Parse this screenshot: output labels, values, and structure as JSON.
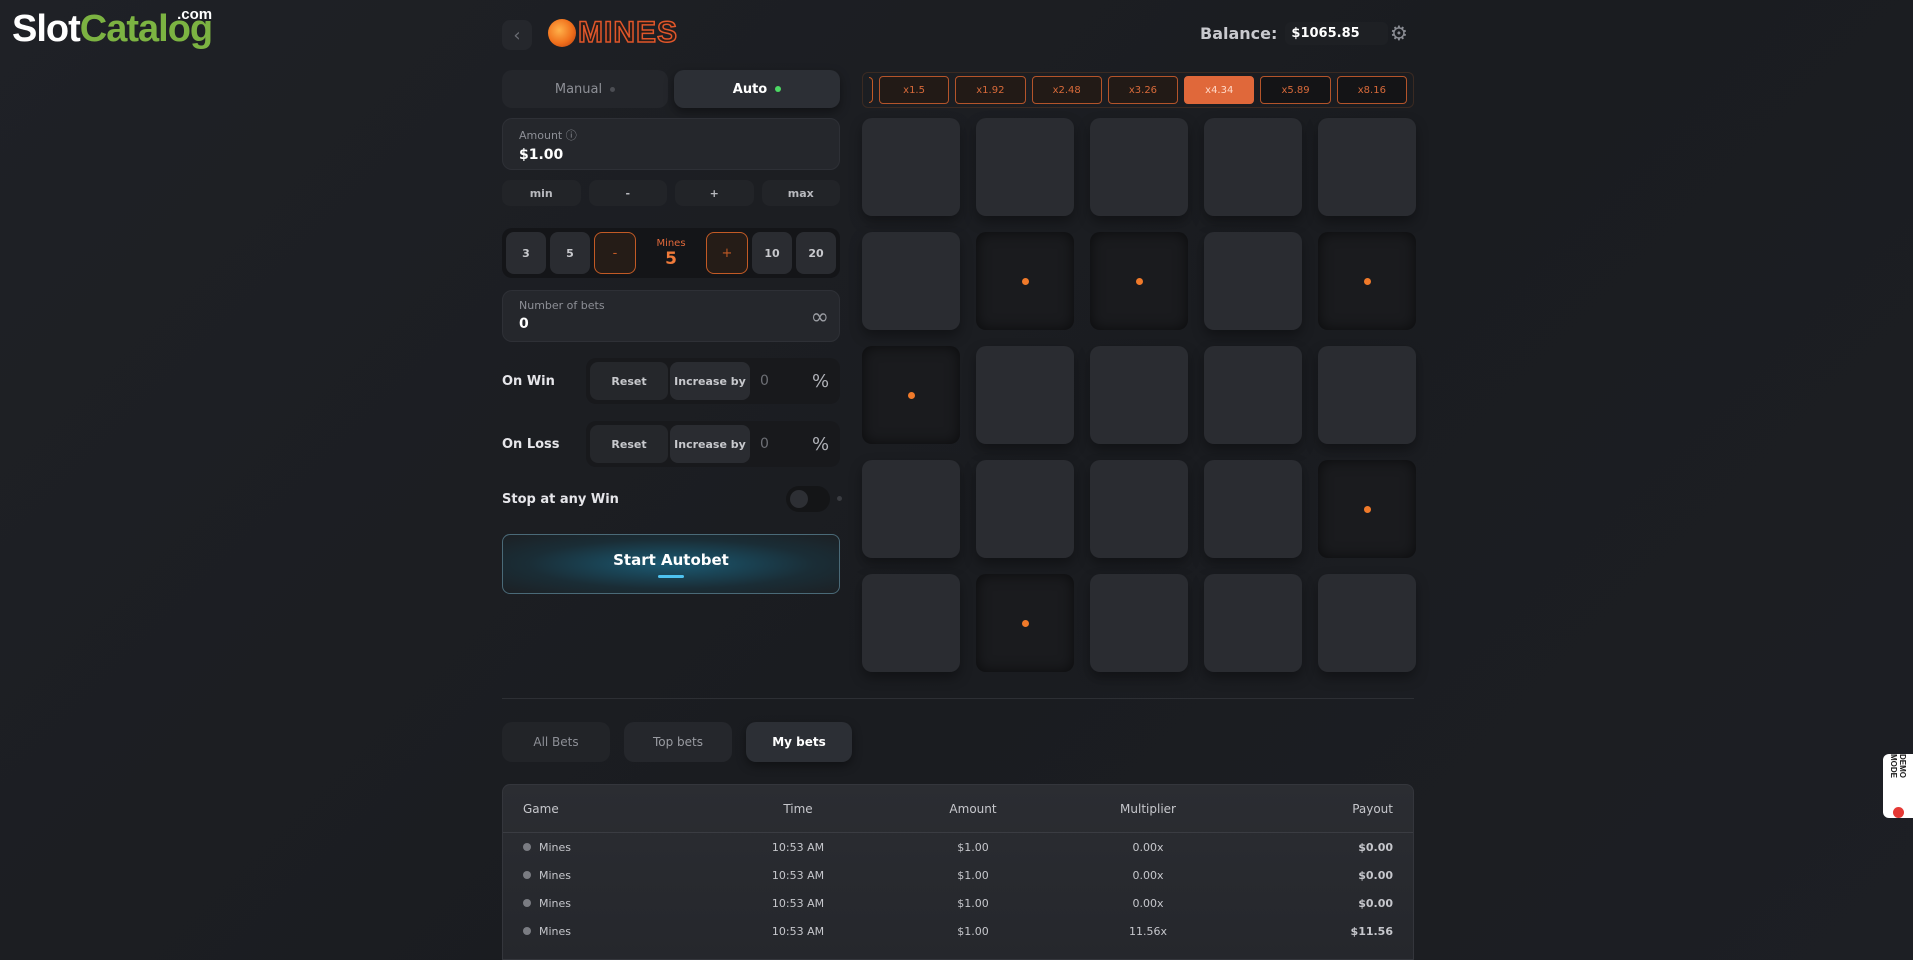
{
  "brand": {
    "slot": "Slot",
    "catalog": "Catalog",
    "com": ".com"
  },
  "header": {
    "back": "‹",
    "game_title": "MINES",
    "balance_label": "Balance:",
    "balance_value": "$1065.85",
    "gear": "⚙"
  },
  "mode_tabs": {
    "manual": "Manual",
    "auto": "Auto"
  },
  "amount": {
    "label": "Amount ⓘ",
    "value": "$1.00",
    "buttons": [
      "min",
      "-",
      "+",
      "max"
    ]
  },
  "mines": {
    "presets_left": [
      "3",
      "5"
    ],
    "minus": "-",
    "label": "Mines",
    "value": "5",
    "plus": "+",
    "presets_right": [
      "10",
      "20"
    ]
  },
  "number_of_bets": {
    "label": "Number of bets",
    "value": "0",
    "infinity": "∞"
  },
  "on_win": {
    "label": "On Win",
    "reset": "Reset",
    "increase": "Increase by",
    "value": "0",
    "pct": "%"
  },
  "on_loss": {
    "label": "On Loss",
    "reset": "Reset",
    "increase": "Increase by",
    "value": "0",
    "pct": "%"
  },
  "stop": {
    "label": "Stop at any Win"
  },
  "start": {
    "label": "Start Autobet"
  },
  "multipliers": [
    "x1.5",
    "x1.92",
    "x2.48",
    "x3.26",
    "x4.34",
    "x5.89",
    "x8.16"
  ],
  "grid": {
    "revealed": [
      6,
      7,
      9,
      10,
      19,
      21
    ]
  },
  "bet_tabs": [
    "All Bets",
    "Top bets",
    "My bets"
  ],
  "table": {
    "headers": [
      "Game",
      "Time",
      "Amount",
      "Multiplier",
      "Payout"
    ],
    "rows": [
      [
        "Mines",
        "10:53 AM",
        "$1.00",
        "0.00x",
        "$0.00"
      ],
      [
        "Mines",
        "10:53 AM",
        "$1.00",
        "0.00x",
        "$0.00"
      ],
      [
        "Mines",
        "10:53 AM",
        "$1.00",
        "0.00x",
        "$0.00"
      ],
      [
        "Mines",
        "10:53 AM",
        "$1.00",
        "11.56x",
        "$11.56"
      ]
    ]
  },
  "demo": {
    "label": "DEMO MODE"
  }
}
